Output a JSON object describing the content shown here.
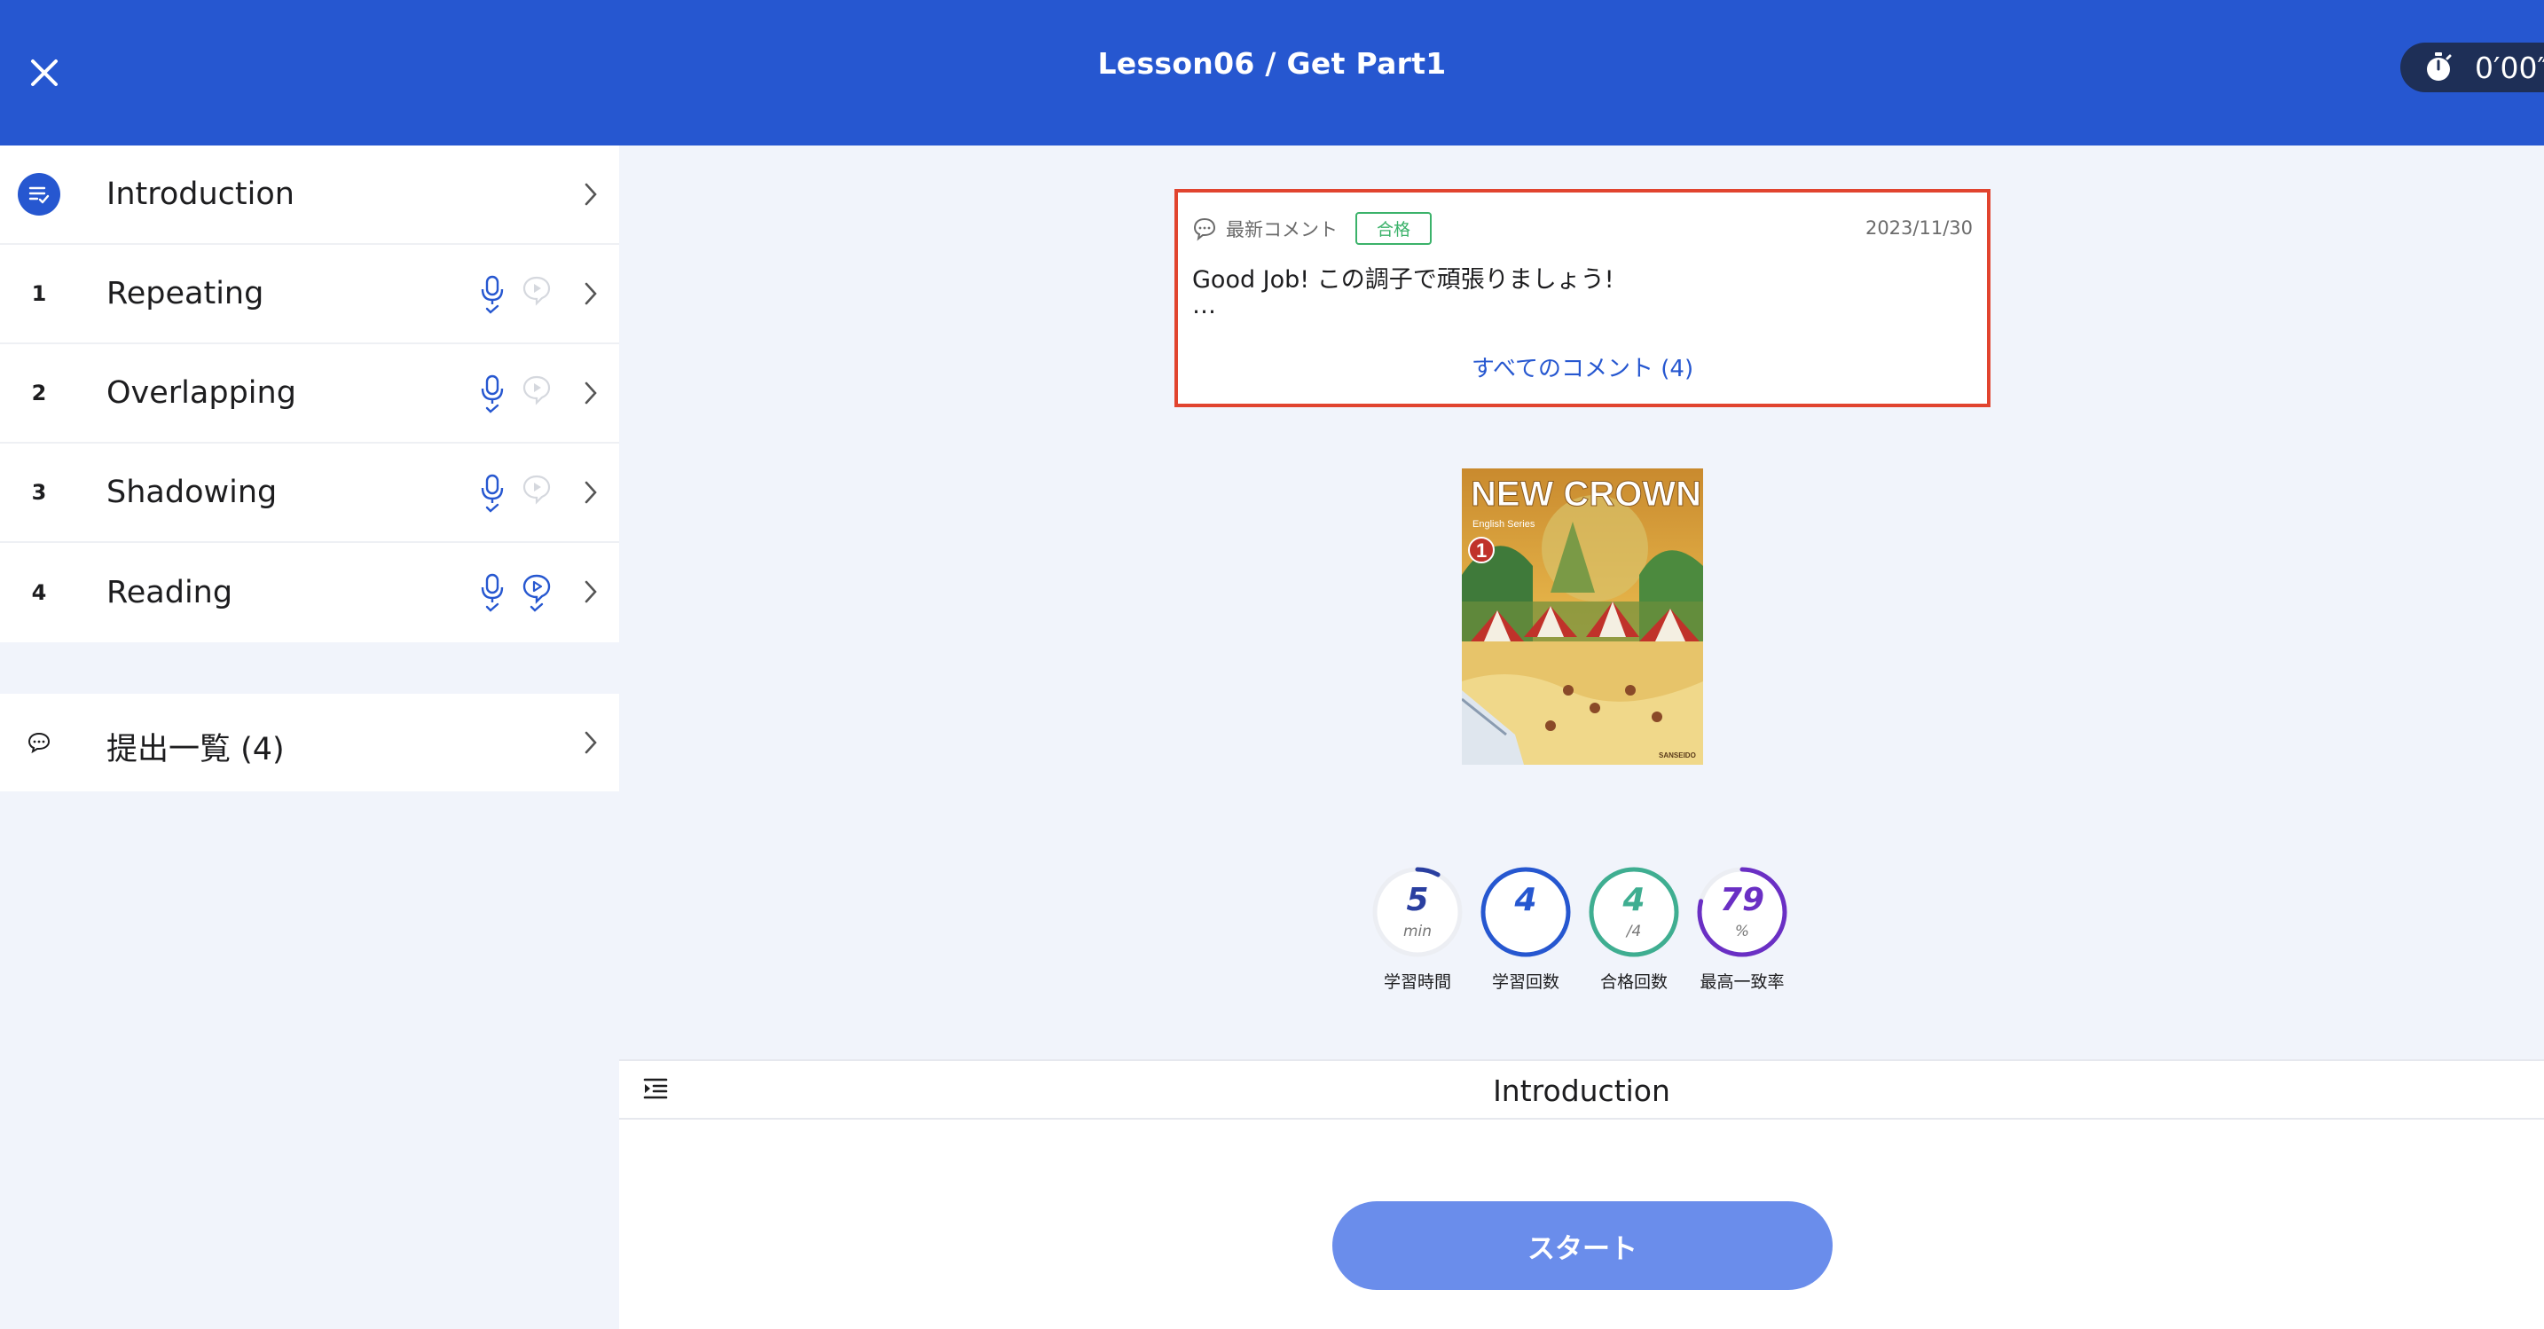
{
  "header": {
    "title": "Lesson06 / Get Part1",
    "timer": "0′00″"
  },
  "sidebar": {
    "items": [
      {
        "index": "",
        "label": "Introduction",
        "icon": "checklist-icon"
      },
      {
        "index": "1",
        "label": "Repeating",
        "mic_done": true,
        "play_done": false
      },
      {
        "index": "2",
        "label": "Overlapping",
        "mic_done": true,
        "play_done": false
      },
      {
        "index": "3",
        "label": "Shadowing",
        "mic_done": true,
        "play_done": false
      },
      {
        "index": "4",
        "label": "Reading",
        "mic_done": true,
        "play_done": true
      }
    ],
    "submissions_label": "提出一覧 (4)"
  },
  "comment": {
    "heading": "最新コメント",
    "badge": "合格",
    "date": "2023/11/30",
    "text": "Good Job! この調子で頑張りましょう!",
    "ellipsis": "…",
    "link": "すべてのコメント (4)"
  },
  "book": {
    "title": "NEW CROWN",
    "volume": "1",
    "subtitle": "English Series",
    "publisher": "SANSEIDO"
  },
  "stats": [
    {
      "value": "5",
      "unit": "min",
      "label": "学習時間",
      "color": "#2a3fa0",
      "progress": 0.08
    },
    {
      "value": "4",
      "unit": "",
      "label": "学習回数",
      "color": "#2657d0",
      "progress": 1
    },
    {
      "value": "4",
      "unit": "/4",
      "label": "合格回数",
      "color": "#3fae91",
      "progress": 1
    },
    {
      "value": "79",
      "unit": "%",
      "label": "最高一致率",
      "color": "#6a2fc4",
      "progress": 0.79
    }
  ],
  "section": {
    "title": "Introduction"
  },
  "start_button": "スタート",
  "colors": {
    "primary": "#2657d0",
    "pass": "#3bb26a",
    "highlight": "#e1442f"
  }
}
